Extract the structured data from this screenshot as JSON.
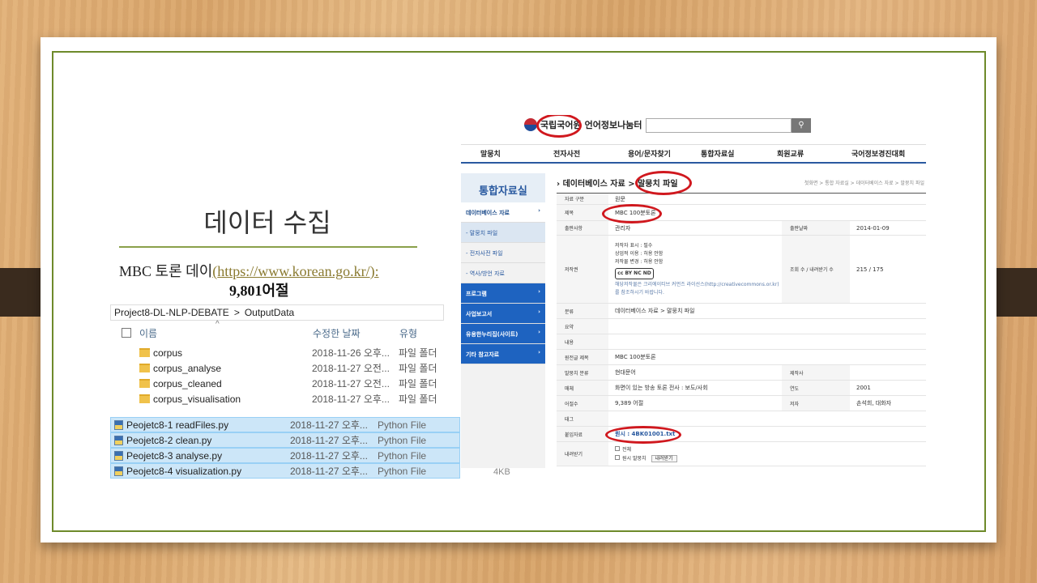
{
  "slide": {
    "title": "데이터 수집",
    "source_prefix": "MBC 토론 데이",
    "source_link": "https://www.korean.go.kr/",
    "source_open": "(",
    "source_close": "):",
    "word_count": "9,801어절"
  },
  "explorer": {
    "path_root": "Project8-DL-NLP-DEBATE",
    "path_sep": ">",
    "path_leaf": "OutputData",
    "columns": {
      "name": "이름",
      "modified": "수정한 날짜",
      "type": "유형"
    },
    "folders": [
      {
        "name": "corpus",
        "date": "2018-11-26 오후...",
        "type": "파일 폴더"
      },
      {
        "name": "corpus_analyse",
        "date": "2018-11-27 오전...",
        "type": "파일 폴더"
      },
      {
        "name": "corpus_cleaned",
        "date": "2018-11-27 오전...",
        "type": "파일 폴더"
      },
      {
        "name": "corpus_visualisation",
        "date": "2018-11-27 오후...",
        "type": "파일 폴더"
      }
    ],
    "files": [
      {
        "name": "Peojetc8-1 readFiles.py",
        "date": "2018-11-27 오후...",
        "type": "Python File"
      },
      {
        "name": "Peojetc8-2 clean.py",
        "date": "2018-11-27 오후...",
        "type": "Python File"
      },
      {
        "name": "Peojetc8-3 analyse.py",
        "date": "2018-11-27 오후...",
        "type": "Python File"
      },
      {
        "name": "Peojetc8-4 visualization.py",
        "date": "2018-11-27 오후...",
        "type": "Python File"
      }
    ],
    "last_size": "4KB"
  },
  "website": {
    "logo_org": "국립국어원",
    "logo_site": "언어정보나눔터",
    "search_icon": "search-icon",
    "nav": [
      "말뭉치",
      "전자사전",
      "용어/문자찾기",
      "통합자료실",
      "회원교류",
      "국어정보경진대회"
    ],
    "sidebar_title": "통합자료실",
    "sidebar": [
      {
        "label": "데이터베이스 자료",
        "style": "act"
      },
      {
        "label": "- 말뭉치 파일",
        "style": "sub"
      },
      {
        "label": "- 전자사전 파일",
        "style": "plain"
      },
      {
        "label": "- 역사/방언 자료",
        "style": "plain"
      },
      {
        "label": "프로그램",
        "style": "blue"
      },
      {
        "label": "사업보고서",
        "style": "blue"
      },
      {
        "label": "유용한누리집(사이트)",
        "style": "blue"
      },
      {
        "label": "기타 참고자료",
        "style": "blue"
      }
    ],
    "breadcrumb_main": "데이터베이스 자료",
    "breadcrumb_sep": ">",
    "breadcrumb_leaf": "말뭉치 파일",
    "breadcrumb_right": "첫화면 > 통합 자료실 > 데이터베이스 자료 > 말뭉치 파일",
    "details": {
      "type_key": "자료 구분",
      "type_val": "원문",
      "title_key": "제목",
      "title_val": "MBC 100분토론",
      "owner_key": "출판사항",
      "owner_val": "관리자",
      "date_key": "출판날짜",
      "date_val": "2014-01-09",
      "rights_key": "저작권",
      "rights_lines": [
        "저작자 표시 : 필수",
        "상업적 이용 : 허용 안함",
        "저작물 변경 : 허용 안함"
      ],
      "cc_badge": "cc BY NC ND",
      "rights_note": "해당저작물은 크리에이티브 커먼즈 라이선스(http://creativecommons.or.kr)를 참조하시기 바랍니다.",
      "views_key": "조회 수 / 내려받기 수",
      "views_val": "215 / 175",
      "class_key": "분류",
      "class_val": "데이터베이스 자료 > 말뭉치 파일",
      "summary_key": "요약",
      "content_key": "내용",
      "orig_key": "원전글 제목",
      "orig_val": "MBC 100분토론",
      "corpus_key": "말뭉치 분류",
      "corpus_val": "현대문어",
      "author_key": "제작사",
      "media_key": "매체",
      "media_val": "화면이 있는 방송 토론 전사 : 보도/사회",
      "year_key": "연도",
      "year_val": "2001",
      "words_key": "어절수",
      "words_val": "9,389 어절",
      "writer_key": "저자",
      "writer_val": "손석희, 대화자",
      "tag_key": "태그",
      "attach_key": "붙임자료",
      "attach_val": "원시 : 4BK01001.txt",
      "download_key": "내려받기",
      "dl_all": "전체",
      "dl_raw": "원시 말뭉치",
      "dl_btn": "내려받기"
    }
  }
}
